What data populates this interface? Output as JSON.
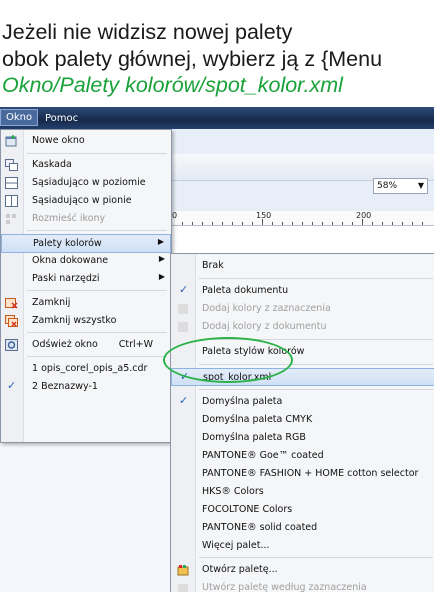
{
  "caption": {
    "line1": "Jeżeli nie widzisz nowej palety",
    "line2": "obok palety głównej, wybierz ją z {Menu",
    "line3": "Okno/Palety kolorów/spot_kolor.xml"
  },
  "menubar": {
    "items": [
      "Okno",
      "Pomoc"
    ]
  },
  "toolbar": {
    "zoom_value": "58%",
    "ruler_labels": [
      "150",
      "200"
    ]
  },
  "okno_menu": {
    "items": [
      {
        "label": "Nowe okno",
        "icon": "new-window-icon"
      },
      {
        "label": "Kaskada",
        "icon": "cascade-icon"
      },
      {
        "label": "Sąsiadująco w poziomie",
        "icon": "tile-horizontal-icon"
      },
      {
        "label": "Sąsiadująco w pionie",
        "icon": "tile-vertical-icon"
      },
      {
        "label": "Rozmieść ikony",
        "icon": "arrange-icons-icon",
        "disabled": true
      },
      {
        "label": "Palety kolorów",
        "submenu": true,
        "highlighted": true
      },
      {
        "label": "Okna dokowane",
        "submenu": true
      },
      {
        "label": "Paski narzędzi",
        "submenu": true
      },
      {
        "label": "Zamknij",
        "icon": "close-window-icon"
      },
      {
        "label": "Zamknij wszystko",
        "icon": "close-all-icon"
      },
      {
        "label": "Odśwież okno",
        "shortcut": "Ctrl+W",
        "icon": "refresh-icon"
      },
      {
        "label": "1 opis_corel_opis_a5.cdr"
      },
      {
        "label": "2 Beznazwy-1",
        "checked": true
      }
    ]
  },
  "palety_submenu": {
    "items": [
      {
        "label": "Brak"
      },
      {
        "label": "Paleta dokumentu",
        "checked": true
      },
      {
        "label": "Dodaj kolory z zaznaczenia",
        "disabled": true
      },
      {
        "label": "Dodaj kolory z dokumentu",
        "disabled": true
      },
      {
        "label": "Paleta stylów kolorów"
      },
      {
        "label": "spot_kolor.xml",
        "checked": true,
        "highlighted": true
      },
      {
        "label": "Domyślna paleta",
        "checked": true
      },
      {
        "label": "Domyślna paleta CMYK"
      },
      {
        "label": "Domyślna paleta RGB"
      },
      {
        "label": "PANTONE® Goe™ coated"
      },
      {
        "label": "PANTONE® FASHION + HOME cotton selector"
      },
      {
        "label": "HKS® Colors"
      },
      {
        "label": "FOCOLTONE Colors"
      },
      {
        "label": "PANTONE® solid coated"
      },
      {
        "label": "Więcej palet..."
      },
      {
        "label": "Otwórz paletę...",
        "icon": "open-palette-icon"
      },
      {
        "label": "Utwórz paletę według zaznaczenia",
        "disabled": true
      }
    ]
  },
  "colors": {
    "caption_highlight": "#1aa23a",
    "highlight_ring": "#2bb34a",
    "menubar": "#1e355e"
  }
}
